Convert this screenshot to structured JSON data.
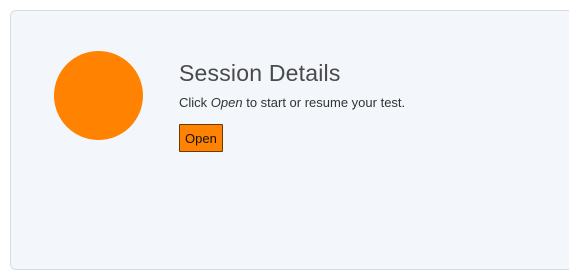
{
  "session": {
    "title": "Session Details",
    "desc_before": "Click ",
    "desc_emphasis": "Open",
    "desc_after": " to start or resume your test.",
    "open_label": "Open"
  },
  "colors": {
    "accent": "#ff8200",
    "card_background": "#f3f6fa",
    "title_text": "#4a4a4a"
  },
  "icons": {
    "avatar": "orange-circle-icon"
  }
}
